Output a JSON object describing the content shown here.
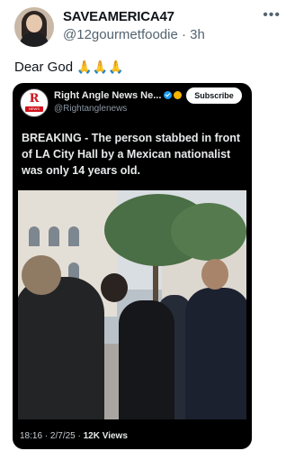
{
  "post": {
    "display_name": "SAVEAMERICA47",
    "handle": "@12gourmetfoodie",
    "separator": "·",
    "time": "3h",
    "text": "Dear God",
    "emojis": "🙏🙏🙏"
  },
  "embed": {
    "source_name": "Right Angle News Ne...",
    "source_handle": "@Rightanglenews",
    "logo_letter": "R",
    "logo_sub": "NEWS",
    "subscribe_label": "Subscribe",
    "text": "BREAKING - The person stabbed in front of LA City Hall by a Mexican nationalist was only 14 years old.",
    "timestamp": "18:16 · 2/7/25 ·",
    "views": "12K Views"
  },
  "icons": {
    "more": "more-icon",
    "verified": "verified-icon"
  },
  "colors": {
    "text_primary": "#0f1419",
    "text_secondary": "#536471",
    "card_background": "#000000",
    "verified_blue": "#1d9bf0"
  }
}
